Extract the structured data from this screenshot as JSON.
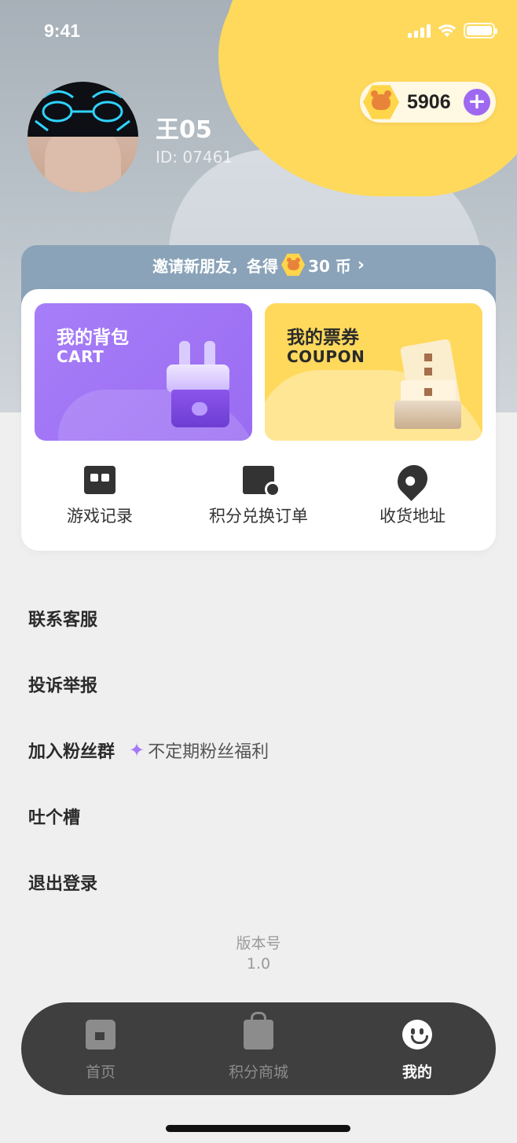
{
  "status_bar": {
    "time": "9:41"
  },
  "profile": {
    "name": "王05",
    "id": "ID: 07461"
  },
  "coins": {
    "balance": "5906",
    "add_label": "+"
  },
  "invite": {
    "text_before": "邀请新朋友，各得",
    "reward": "30 币",
    "chevron": "›"
  },
  "cards": {
    "cart": {
      "title": "我的背包",
      "subtitle": "CART"
    },
    "coupon": {
      "title": "我的票券",
      "subtitle": "COUPON"
    }
  },
  "quick_links": [
    {
      "label": "游戏记录",
      "icon": "game-controller-icon"
    },
    {
      "label": "积分兑换订单",
      "icon": "order-receipt-icon"
    },
    {
      "label": "收货地址",
      "icon": "location-pin-icon"
    }
  ],
  "menu": {
    "items": [
      {
        "label": "联系客服"
      },
      {
        "label": "投诉举报"
      },
      {
        "label": "加入粉丝群",
        "note": "不定期粉丝福利"
      },
      {
        "label": "吐个槽"
      },
      {
        "label": "退出登录"
      }
    ]
  },
  "version": {
    "label": "版本号",
    "value": "1.0"
  },
  "tabbar": {
    "tabs": [
      {
        "label": "首页",
        "icon": "home-icon"
      },
      {
        "label": "积分商城",
        "icon": "shop-bag-icon"
      },
      {
        "label": "我的",
        "icon": "smiley-icon",
        "active": true
      }
    ]
  },
  "colors": {
    "accent_purple": "#9e69f0",
    "accent_yellow": "#ffd95c",
    "tabbar_bg": "#3f3f3f"
  }
}
